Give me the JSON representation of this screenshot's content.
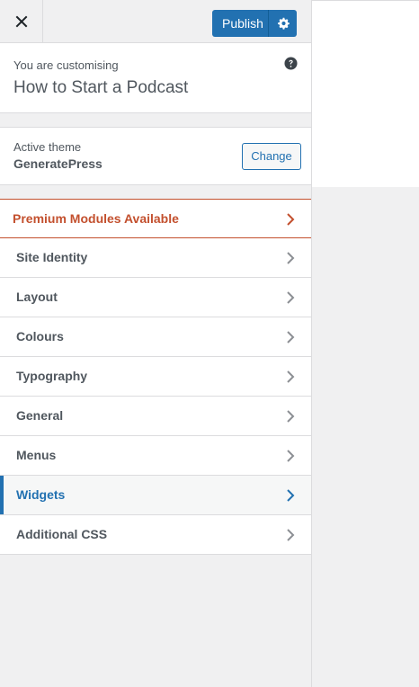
{
  "header": {
    "close_icon": "close-icon",
    "publish_label": "Publish",
    "settings_icon": "gear-icon"
  },
  "info": {
    "subtitle": "You are customising",
    "title": "How to Start a Podcast",
    "help_icon": "help-icon"
  },
  "theme": {
    "label": "Active theme",
    "name": "GeneratePress",
    "change_label": "Change"
  },
  "menu": {
    "items": [
      {
        "label": "Premium Modules Available"
      },
      {
        "label": "Site Identity"
      },
      {
        "label": "Layout"
      },
      {
        "label": "Colours"
      },
      {
        "label": "Typography"
      },
      {
        "label": "General"
      },
      {
        "label": "Menus"
      },
      {
        "label": "Widgets"
      },
      {
        "label": "Additional CSS"
      }
    ]
  },
  "colors": {
    "accent": "#2271b1",
    "premium": "#c3502e",
    "text": "#50575e",
    "sidebar_bg": "#f0f0f1"
  }
}
